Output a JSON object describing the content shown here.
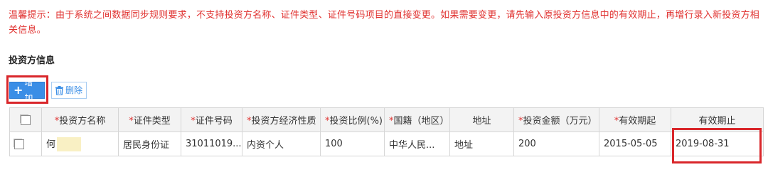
{
  "notice": "温馨提示：由于系统之间数据同步规则要求，不支持投资方名称、证件类型、证件号码项目的直接变更。如果需要变更，请先输入原投资方信息中的有效期止，再增行录入新投资方相关信息。",
  "section_title": "投资方信息",
  "toolbar": {
    "add_label": "增加",
    "delete_label": "删除"
  },
  "table": {
    "columns": [
      {
        "label": "投资方名称",
        "required": true
      },
      {
        "label": "证件类型",
        "required": true
      },
      {
        "label": "证件号码",
        "required": true
      },
      {
        "label": "投资方经济性质",
        "required": true
      },
      {
        "label": "投资比例(%)",
        "required": true
      },
      {
        "label": "国籍（地区）",
        "required": true
      },
      {
        "label": "地址",
        "required": false
      },
      {
        "label": "投资金额（万元）",
        "required": true
      },
      {
        "label": "有效期起",
        "required": true
      },
      {
        "label": "有效期止",
        "required": false
      }
    ],
    "rows": [
      {
        "name": "何",
        "id_type": "居民身份证",
        "id_number": "31011019...",
        "economic_nature": "内资个人",
        "ratio": "100",
        "nationality": "中华人民...",
        "address": "地址",
        "amount": "200",
        "valid_from": "2015-05-05",
        "valid_to": "2019-08-31"
      }
    ]
  },
  "colors": {
    "notice_red": "#e0312f",
    "highlight_red": "#d9262a",
    "primary_blue": "#3a8ee6",
    "header_bg": "#f3f3f3"
  },
  "icons": {
    "add": "plus-icon",
    "delete": "trash-icon"
  }
}
